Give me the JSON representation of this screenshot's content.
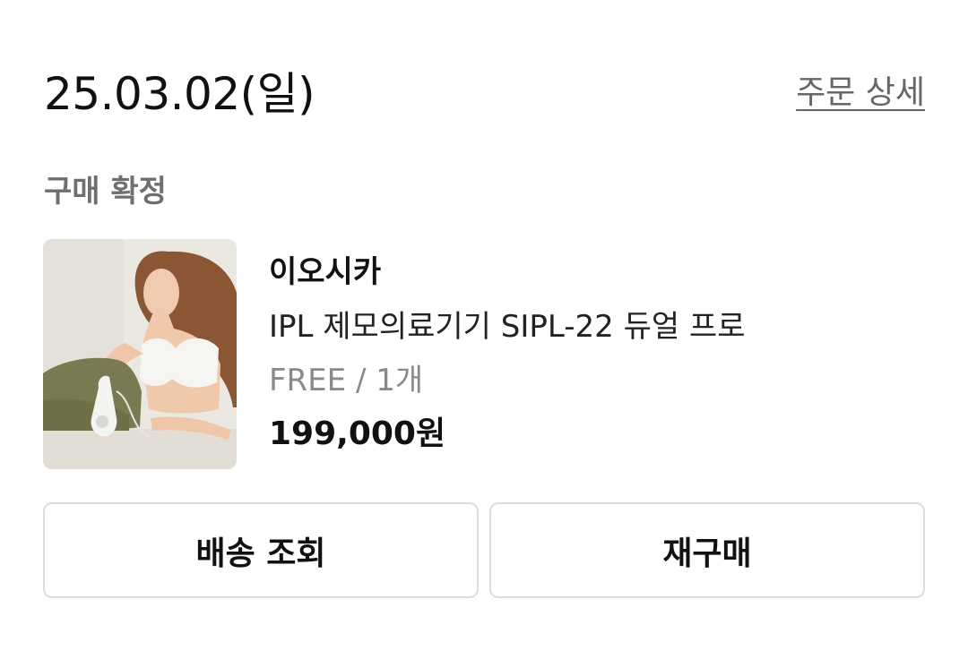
{
  "order": {
    "date": "25.03.02(일)",
    "detail_link": "주문 상세",
    "status": "구매 확정"
  },
  "product": {
    "brand": "이오시카",
    "name": "IPL 제모의료기기 SIPL-22 듀얼 프로",
    "option": "FREE / 1개",
    "price": "199,000원",
    "image": "product-photo-woman-with-ipl-device"
  },
  "actions": {
    "track_delivery": "배송 조회",
    "rebuy": "재구매"
  }
}
